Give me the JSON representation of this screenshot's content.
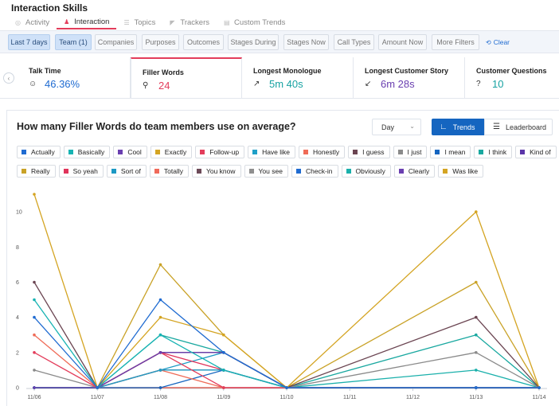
{
  "app_title": "Interaction Skills",
  "tabs": [
    {
      "label": "Activity",
      "icon": "activity-icon",
      "active": false
    },
    {
      "label": "Interaction",
      "icon": "interaction-icon",
      "active": true
    },
    {
      "label": "Topics",
      "icon": "topics-icon",
      "active": false
    },
    {
      "label": "Trackers",
      "icon": "trackers-icon",
      "active": false
    },
    {
      "label": "Custom Trends",
      "icon": "custom-trends-icon",
      "active": false
    }
  ],
  "filters": [
    {
      "label": "Last 7 days",
      "active": true
    },
    {
      "label": "Team (1)",
      "active": true
    },
    {
      "label": "Companies",
      "active": false
    },
    {
      "label": "Purposes",
      "active": false
    },
    {
      "label": "Outcomes",
      "active": false
    },
    {
      "label": "Stages During",
      "active": false
    },
    {
      "label": "Stages Now",
      "active": false
    },
    {
      "label": "Call Types",
      "active": false
    },
    {
      "label": "Amount Now",
      "active": false
    },
    {
      "label": "More Filters",
      "active": false
    }
  ],
  "clear_label": "Clear",
  "metrics": [
    {
      "label": "Talk Time",
      "value": "46.36%",
      "color": "#1f6bd1",
      "icon": "talk-time-icon"
    },
    {
      "label": "Filler Words",
      "value": "24",
      "color": "#e33d5b",
      "icon": "filler-words-icon"
    },
    {
      "label": "Longest Monologue",
      "value": "5m 40s",
      "color": "#17a2a2",
      "icon": "monologue-icon"
    },
    {
      "label": "Longest Customer Story",
      "value": "6m 28s",
      "color": "#6a3fb0",
      "icon": "customer-story-icon"
    },
    {
      "label": "Customer Questions",
      "value": "10",
      "color": "#17a2a2",
      "icon": "customer-questions-icon"
    }
  ],
  "panel": {
    "title": "How many Filler Words do team members use on average?",
    "period": "Day",
    "trends_label": "Trends",
    "leaderboard_label": "Leaderboard"
  },
  "chart_data": {
    "type": "line",
    "x": [
      "11/06",
      "11/07",
      "11/08",
      "11/09",
      "11/10",
      "11/11",
      "11/12",
      "11/13",
      "11/14"
    ],
    "ylim": [
      0,
      11
    ],
    "yticks": [
      0,
      2,
      4,
      6,
      8,
      10
    ],
    "grid": false,
    "legend_position": "top",
    "series": [
      {
        "name": "Actually",
        "color": "#1f6bd1",
        "values": [
          4,
          0,
          5,
          2,
          0,
          null,
          null,
          0,
          0
        ]
      },
      {
        "name": "Basically",
        "color": "#17b3b3",
        "values": [
          5,
          0,
          3,
          1,
          0,
          null,
          null,
          0,
          0
        ]
      },
      {
        "name": "Cool",
        "color": "#6a3fb0",
        "values": [
          0,
          0,
          2,
          2,
          0,
          null,
          null,
          0,
          0
        ]
      },
      {
        "name": "Exactly",
        "color": "#d4a422",
        "values": [
          11,
          0,
          4,
          3,
          0,
          null,
          null,
          10,
          0
        ]
      },
      {
        "name": "Follow-up",
        "color": "#e33d5b",
        "values": [
          2,
          0,
          2,
          0,
          0,
          null,
          null,
          0,
          0
        ]
      },
      {
        "name": "Have like",
        "color": "#1e9fc7",
        "values": [
          0,
          0,
          1,
          1,
          0,
          null,
          null,
          0,
          0
        ]
      },
      {
        "name": "Honestly",
        "color": "#ef6b57",
        "values": [
          3,
          0,
          1,
          0,
          0,
          null,
          null,
          0,
          0
        ]
      },
      {
        "name": "I guess",
        "color": "#6b4552",
        "values": [
          6,
          0,
          2,
          2,
          0,
          null,
          null,
          4,
          0
        ]
      },
      {
        "name": "I just",
        "color": "#8a8a8a",
        "values": [
          1,
          0,
          1,
          1,
          0,
          null,
          null,
          2,
          0
        ]
      },
      {
        "name": "I mean",
        "color": "#1565c0",
        "values": [
          0,
          0,
          0,
          1,
          0,
          null,
          null,
          0,
          0
        ]
      },
      {
        "name": "I think",
        "color": "#19a8a0",
        "values": [
          0,
          0,
          3,
          2,
          0,
          null,
          null,
          3,
          0
        ]
      },
      {
        "name": "Kind of",
        "color": "#5a35a8",
        "values": [
          0,
          0,
          1,
          1,
          0,
          null,
          null,
          0,
          0
        ]
      },
      {
        "name": "Really",
        "color": "#c9a227",
        "values": [
          0,
          0,
          7,
          3,
          0,
          null,
          null,
          6,
          0
        ]
      },
      {
        "name": "So yeah",
        "color": "#e0345b",
        "values": [
          0,
          0,
          2,
          1,
          0,
          null,
          null,
          0,
          0
        ]
      },
      {
        "name": "Sort of",
        "color": "#1c99c4",
        "values": [
          0,
          0,
          1,
          2,
          0,
          null,
          null,
          0,
          0
        ]
      },
      {
        "name": "Totally",
        "color": "#f06a5a",
        "values": [
          0,
          0,
          0,
          0,
          0,
          null,
          null,
          0,
          0
        ]
      },
      {
        "name": "You know",
        "color": "#6c4a58",
        "values": [
          0,
          0,
          2,
          2,
          0,
          null,
          null,
          0,
          0
        ]
      },
      {
        "name": "You see",
        "color": "#8f8f8f",
        "values": [
          0,
          0,
          2,
          2,
          0,
          null,
          null,
          0,
          0
        ]
      },
      {
        "name": "Check-in",
        "color": "#1f6bd1",
        "values": [
          0,
          0,
          1,
          1,
          0,
          null,
          null,
          0,
          0
        ]
      },
      {
        "name": "Obviously",
        "color": "#1ab0ab",
        "values": [
          0,
          0,
          1,
          1,
          0,
          null,
          null,
          1,
          0
        ]
      },
      {
        "name": "Clearly",
        "color": "#6a3fb0",
        "values": [
          0,
          0,
          0,
          0,
          0,
          null,
          null,
          0,
          0
        ]
      },
      {
        "name": "Was like",
        "color": "#d4a422",
        "values": [
          0,
          0,
          0,
          0,
          0,
          null,
          null,
          0,
          0
        ]
      }
    ]
  }
}
